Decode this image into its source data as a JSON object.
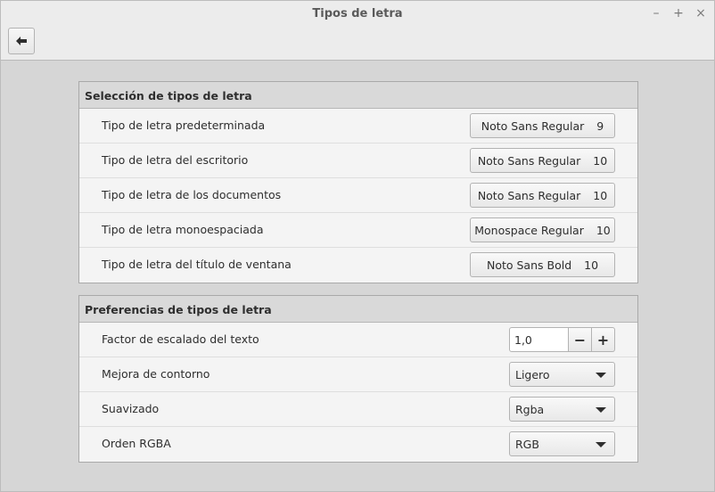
{
  "window": {
    "title": "Tipos de letra",
    "controls": {
      "minimize": "–",
      "maximize": "+",
      "close": "×"
    }
  },
  "header": {
    "back_icon": "back-arrow-icon"
  },
  "font_selection": {
    "heading": "Selección de tipos de letra",
    "rows": [
      {
        "label": "Tipo de letra predeterminada",
        "font": "Noto Sans Regular",
        "size": "9"
      },
      {
        "label": "Tipo de letra del escritorio",
        "font": "Noto Sans Regular",
        "size": "10"
      },
      {
        "label": "Tipo de letra de los documentos",
        "font": "Noto Sans Regular",
        "size": "10"
      },
      {
        "label": "Tipo de letra monoespaciada",
        "font": "Monospace Regular",
        "size": "10"
      },
      {
        "label": "Tipo de letra del título de ventana",
        "font": "Noto Sans Bold",
        "size": "10"
      }
    ]
  },
  "font_preferences": {
    "heading": "Preferencias de tipos de letra",
    "scaling": {
      "label": "Factor de escalado del texto",
      "value": "1,0",
      "minus": "−",
      "plus": "+"
    },
    "hinting": {
      "label": "Mejora de contorno",
      "value": "Ligero"
    },
    "antialiasing": {
      "label": "Suavizado",
      "value": "Rgba"
    },
    "rgba_order": {
      "label": "Orden RGBA",
      "value": "RGB"
    }
  }
}
